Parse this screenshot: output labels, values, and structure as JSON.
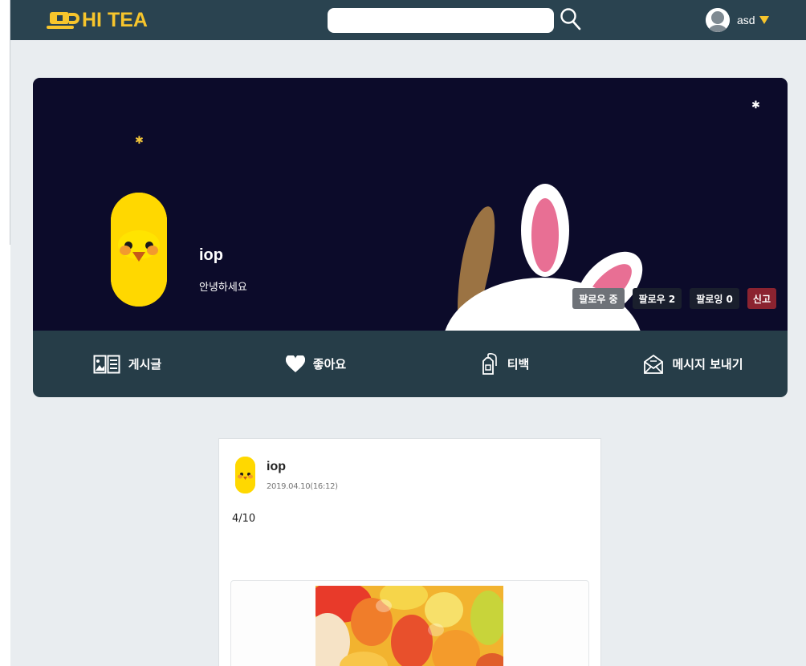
{
  "header": {
    "logo_text": "HI TEA",
    "search_value": "",
    "username": "asd"
  },
  "profile": {
    "name": "iop",
    "bio": "안녕하세요",
    "buttons": {
      "following": "팔로우 중",
      "followers": "팔로우 2",
      "followings": "팔로잉 0",
      "report": "신고"
    },
    "tabs": [
      "게시글",
      "좋아요",
      "티백",
      "메시지 보내기"
    ]
  },
  "post": {
    "author": "iop",
    "date": "2019.04.10(16:12)",
    "body": "4/10"
  },
  "colors": {
    "header_bg": "#2a4350",
    "accent": "#f7c52c",
    "banner_bg": "#0c0b2a",
    "tab_bar_bg": "#263d48",
    "report": "#8b2330",
    "page_bg": "#e9edf0"
  },
  "icons": {
    "logo": "teacup-icon",
    "search": "search-icon",
    "user": "user-avatar-icon",
    "dropdown": "caret-down-icon",
    "posts_tab": "document-icon",
    "likes_tab": "heart-icon",
    "teabag_tab": "teabag-icon",
    "message_tab": "envelope-icon"
  }
}
